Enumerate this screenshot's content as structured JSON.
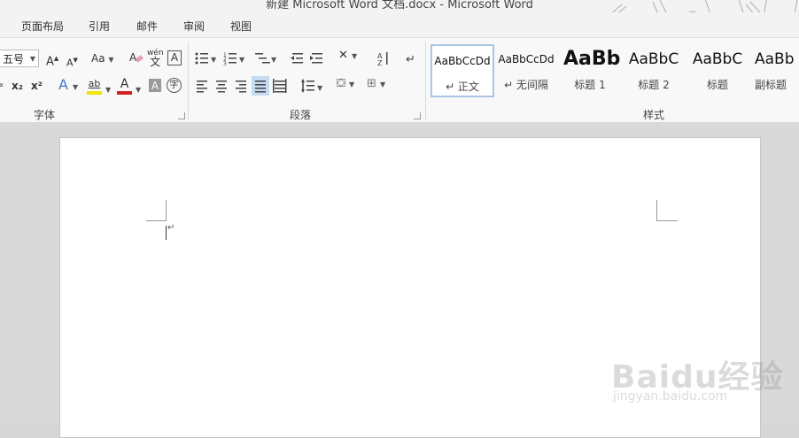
{
  "window": {
    "title": "新建 Microsoft Word 文档.docx - Microsoft Word"
  },
  "tabs": [
    "页面布局",
    "引用",
    "邮件",
    "审阅",
    "视图"
  ],
  "font_group": {
    "size_value": "五号",
    "grow_label": "A",
    "shrink_label": "A",
    "case_label": "Aa",
    "phonetic_label": "wén",
    "phonetic_char": "文",
    "border_char": "A",
    "subscript_label": "x₂",
    "superscript_label": "x²",
    "effects_label": "A",
    "highlight_label": "ab",
    "font_color_label": "A",
    "shade_char": "A",
    "enclose_char": "字",
    "group_label": "字体"
  },
  "paragraph_group": {
    "group_label": "段落"
  },
  "styles_group": {
    "group_label": "样式",
    "items": [
      {
        "sample": "AaBbCcDd",
        "name": "↵ 正文"
      },
      {
        "sample": "AaBbCcDd",
        "name": "↵ 无间隔"
      },
      {
        "sample": "AaBb",
        "name": "标题 1"
      },
      {
        "sample": "AaBbC",
        "name": "标题 2"
      },
      {
        "sample": "AaBbC",
        "name": "标题"
      },
      {
        "sample": "AaBb",
        "name": "副标题"
      }
    ]
  },
  "document": {
    "paragraph_mark": "↵"
  },
  "watermark": {
    "brand": "Baidu经验",
    "url": "jingyan.baidu.com"
  },
  "colors": {
    "highlight": "#f3e500",
    "font_red": "#d32020",
    "selected_style_border": "#a9c4e6"
  }
}
